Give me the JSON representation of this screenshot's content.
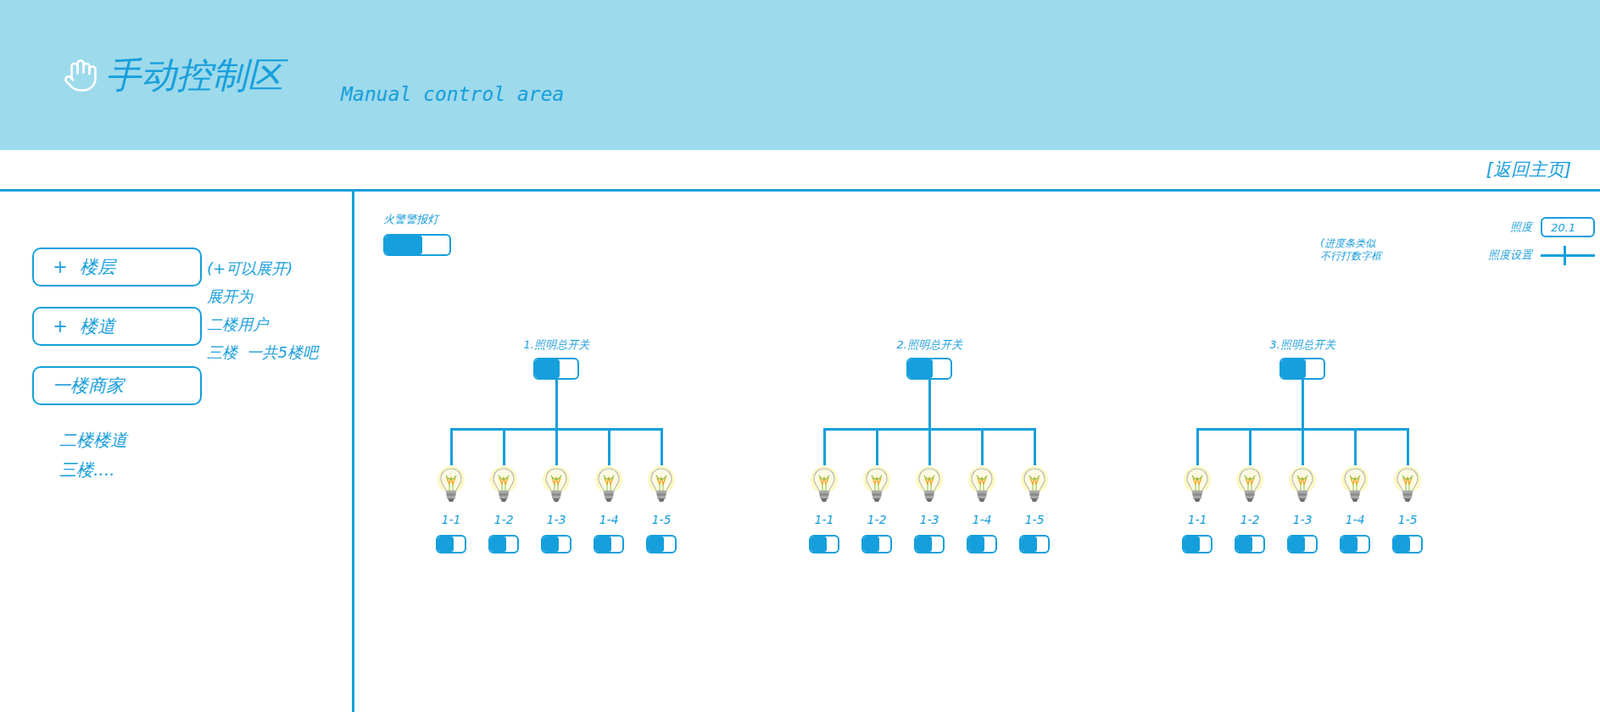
{
  "header": {
    "title": "手动控制区",
    "subtitle": "Manual control area"
  },
  "nav": {
    "back_link": "[返回主页]"
  },
  "sidebar": {
    "items": [
      {
        "kind": "box",
        "expander": "+",
        "label": "楼层"
      },
      {
        "kind": "box",
        "expander": "+",
        "label": "楼道"
      },
      {
        "kind": "box",
        "label": "一楼商家"
      },
      {
        "kind": "text",
        "label": "二楼楼道"
      },
      {
        "kind": "text",
        "label": "三楼...."
      }
    ],
    "notes": [
      "(+可以展开)",
      "展开为",
      "二楼用户",
      "三楼  一共5楼吧"
    ]
  },
  "fire_alarm": {
    "label": "火警警报灯",
    "on": true
  },
  "illuminance": {
    "label": "照度",
    "value": "20.1",
    "setting_label": "照度设置",
    "level": 0.44,
    "note": [
      "(进度条类似",
      "不行打数字框"
    ]
  },
  "groups": [
    {
      "title": "1.照明总开关",
      "on": true,
      "lights": [
        {
          "label": "1-1",
          "on": true
        },
        {
          "label": "1-2",
          "on": true
        },
        {
          "label": "1-3",
          "on": true
        },
        {
          "label": "1-4",
          "on": true
        },
        {
          "label": "1-5",
          "on": true
        }
      ]
    },
    {
      "title": "2.照明总开关",
      "on": true,
      "lights": [
        {
          "label": "1-1",
          "on": true
        },
        {
          "label": "1-2",
          "on": true
        },
        {
          "label": "1-3",
          "on": true
        },
        {
          "label": "1-4",
          "on": true
        },
        {
          "label": "1-5",
          "on": true
        }
      ]
    },
    {
      "title": "3.照明总开关",
      "on": true,
      "lights": [
        {
          "label": "1-1",
          "on": true
        },
        {
          "label": "1-2",
          "on": true
        },
        {
          "label": "1-3",
          "on": true
        },
        {
          "label": "1-4",
          "on": true
        },
        {
          "label": "1-5",
          "on": true
        }
      ]
    }
  ]
}
